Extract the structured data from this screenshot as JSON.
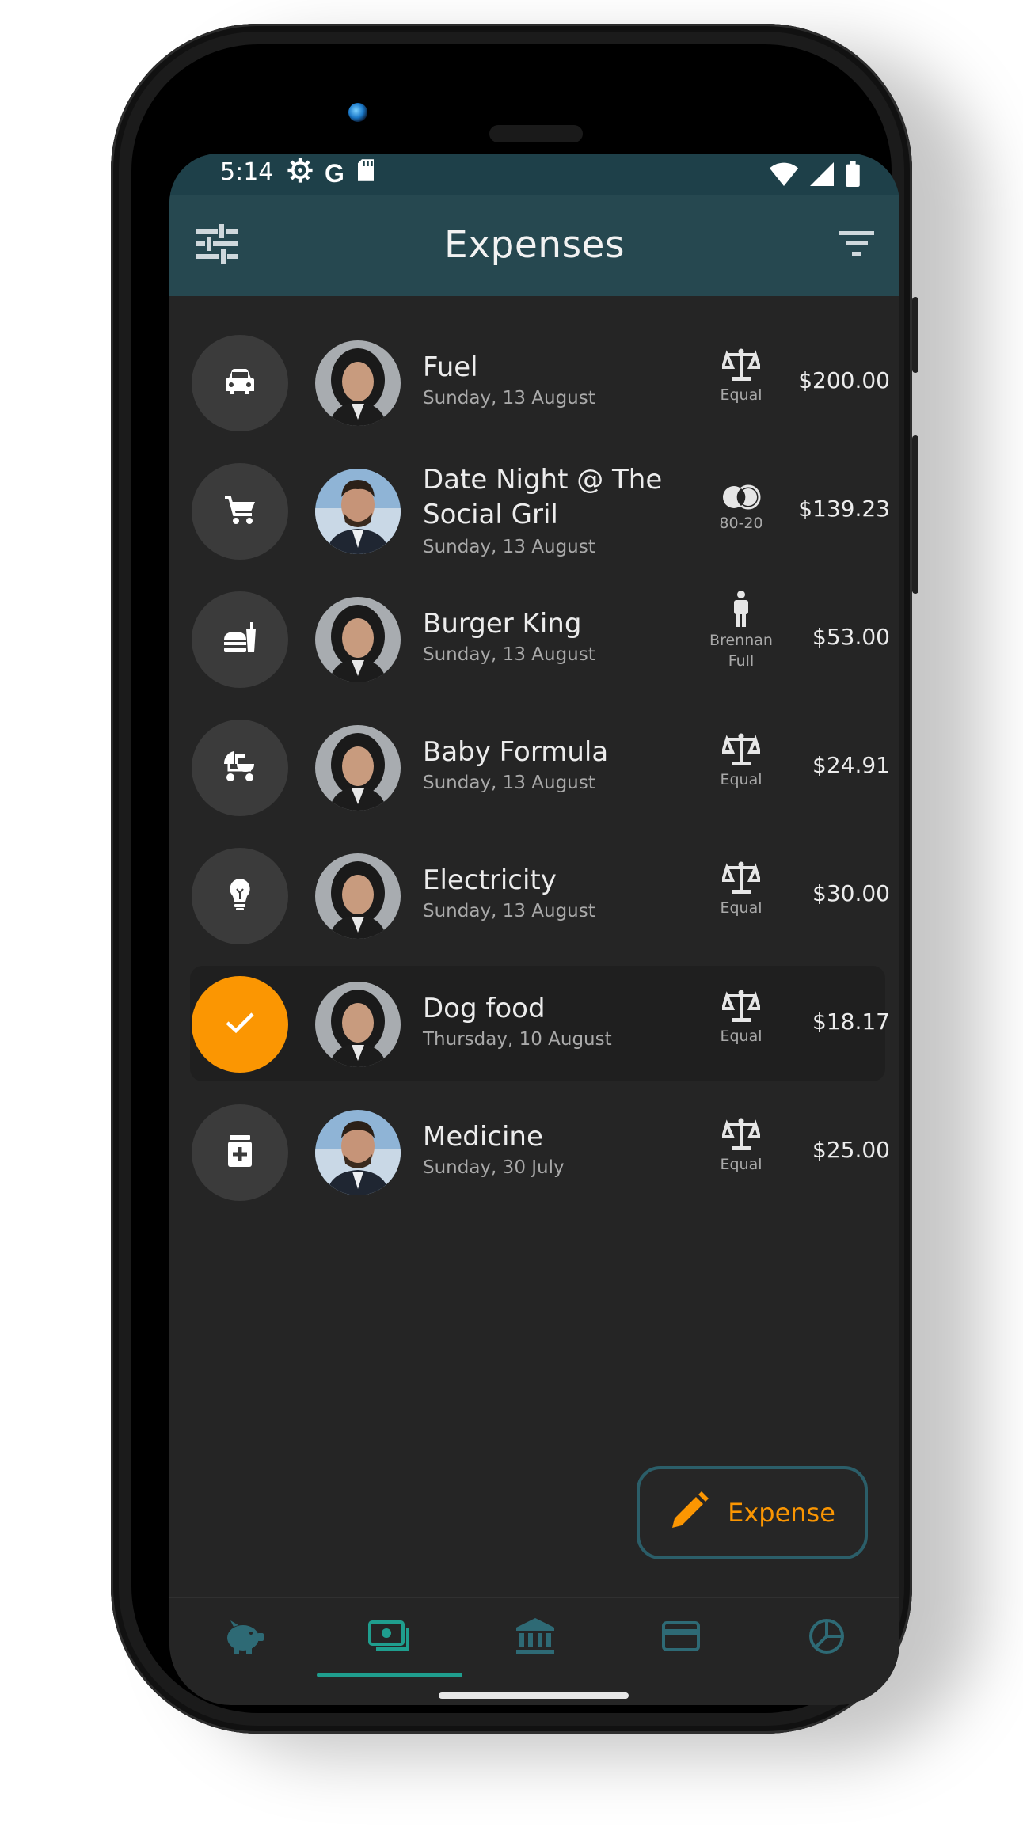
{
  "status_bar": {
    "time": "5:14",
    "left_icons": [
      "gear-icon",
      "google-icon",
      "sd-card-icon"
    ],
    "right_icons": [
      "wifi-icon",
      "signal-icon",
      "battery-icon"
    ]
  },
  "app_bar": {
    "title": "Expenses",
    "left_icon": "tune-icon",
    "right_icon": "filter-icon"
  },
  "colors": {
    "app_bar": "#264850",
    "status_bar": "#1e4049",
    "background": "#252525",
    "accent": "#fb9602",
    "teal": "#1f9e8e",
    "fab_border": "#2b5e69"
  },
  "expenses": [
    {
      "title": "Fuel",
      "date": "Sunday, 13 August",
      "category_icon": "car-icon",
      "payer": "woman",
      "split_icon": "scale-icon",
      "split_label": "Equal",
      "amount": "$200.00",
      "selected": false
    },
    {
      "title": "Date Night @ The Social Gril",
      "title_line1": "Date Night @ The",
      "title_line2": "Social Gril",
      "date": "Sunday, 13 August",
      "category_icon": "cart-icon",
      "payer": "man",
      "split_icon": "overlap-circles-icon",
      "split_label": "80-20",
      "amount": "$139.23",
      "selected": false
    },
    {
      "title": "Burger King",
      "date": "Sunday, 13 August",
      "category_icon": "fastfood-icon",
      "payer": "woman",
      "split_icon": "person-icon",
      "split_label": "Brennan Full",
      "split_label_line1": "Brennan",
      "split_label_line2": "Full",
      "amount": "$53.00",
      "selected": false
    },
    {
      "title": "Baby Formula",
      "date": "Sunday, 13 August",
      "category_icon": "stroller-icon",
      "payer": "woman",
      "split_icon": "scale-icon",
      "split_label": "Equal",
      "amount": "$24.91",
      "selected": false
    },
    {
      "title": "Electricity",
      "date": "Sunday, 13 August",
      "category_icon": "lightbulb-icon",
      "payer": "woman",
      "split_icon": "scale-icon",
      "split_label": "Equal",
      "amount": "$30.00",
      "selected": false
    },
    {
      "title": "Dog food",
      "date": "Thursday, 10 August",
      "category_icon": "check-icon",
      "payer": "woman",
      "split_icon": "scale-icon",
      "split_label": "Equal",
      "amount": "$18.17",
      "selected": true
    },
    {
      "title": "Medicine",
      "date": "Sunday, 30 July",
      "category_icon": "medicine-icon",
      "payer": "man",
      "split_icon": "scale-icon",
      "split_label": "Equal",
      "amount": "$25.00",
      "selected": false
    }
  ],
  "fab": {
    "label": "Expense",
    "icon": "pencil-icon"
  },
  "bottom_nav": [
    {
      "icon": "piggy-bank-icon",
      "active": false
    },
    {
      "icon": "money-icon",
      "active": true
    },
    {
      "icon": "bank-icon",
      "active": false
    },
    {
      "icon": "credit-card-icon",
      "active": false
    },
    {
      "icon": "pie-chart-icon",
      "active": false
    }
  ]
}
